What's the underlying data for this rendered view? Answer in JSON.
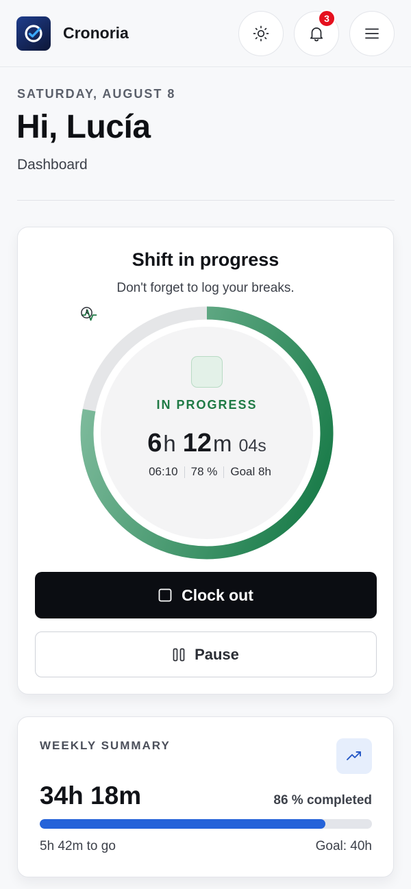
{
  "app": {
    "brand": "Cronoria",
    "notification_count": "3",
    "icons": {
      "logo": "check-clock-icon",
      "theme": "sun-icon",
      "notifications": "bell-icon",
      "menu": "hamburger-icon"
    }
  },
  "header": {
    "date": "SATURDAY, AUGUST 8",
    "greeting": "Hi, Lucía",
    "subtitle": "Dashboard"
  },
  "shift": {
    "title": "Shift in progress",
    "hint": "Don't forget to log your breaks.",
    "status": "IN PROGRESS",
    "elapsed_hours": "6",
    "elapsed_hours_unit": "h",
    "elapsed_minutes": "12",
    "elapsed_minutes_unit": "m",
    "elapsed_seconds": "04s",
    "start_time": "06:10",
    "percent_label": "78 %",
    "goal_label": "Goal 8h",
    "progress": 0.78,
    "clock_out_label": "Clock out",
    "pause_label": "Pause",
    "colors": {
      "accent": "#1f7a45",
      "ring_start": "#7bb99a",
      "ring_end": "#177a47",
      "track": "#e5e6e8"
    }
  },
  "weekly": {
    "title": "WEEKLY SUMMARY",
    "total": "34h 18m",
    "completed_label": "86 % completed",
    "progress": 0.86,
    "to_go": "5h 42m to go",
    "goal": "Goal: 40h",
    "colors": {
      "bar": "#2563d9",
      "track": "#e3e5ea"
    },
    "icon": "trending-up-icon"
  }
}
